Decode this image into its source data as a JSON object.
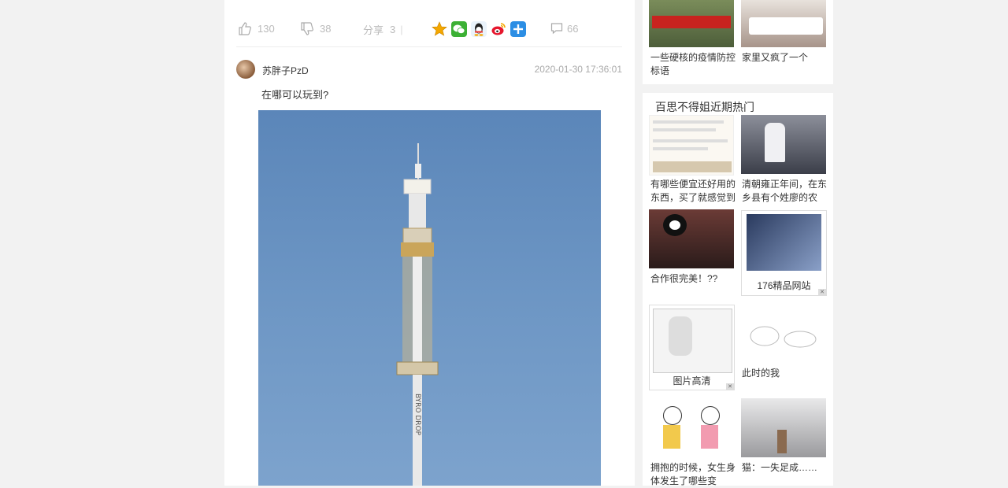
{
  "actions": {
    "likes": "130",
    "dislikes": "38",
    "share_label": "分享",
    "share_count": "3",
    "comments": "66"
  },
  "post": {
    "username": "苏胖子PzD",
    "timestamp": "2020-01-30 17:36:01",
    "comment_text": "在哪可以玩到?"
  },
  "sidebar": {
    "top_items": [
      {
        "caption": "一些硬核的疫情防控标语"
      },
      {
        "caption": "家里又疯了一个"
      }
    ],
    "section_title": "百思不得姐近期热门",
    "items": [
      {
        "caption": "有哪些便宜还好用的东西，买了就感觉到"
      },
      {
        "caption": "清朝雍正年间，在东乡县有个姓廖的农"
      },
      {
        "caption": "合作很完美！??"
      },
      {
        "caption": "176精品网站"
      },
      {
        "caption": "图片高清"
      },
      {
        "caption": "此时的我"
      },
      {
        "caption": "拥抱的时候，女生身体发生了哪些变"
      },
      {
        "caption": "猫：一失足成……"
      }
    ]
  },
  "colors": {
    "sky": "#6d96c4",
    "wechat": "#3cb034",
    "weibo": "#e6162d",
    "qq": "#1296db",
    "star": "#f4a700"
  }
}
